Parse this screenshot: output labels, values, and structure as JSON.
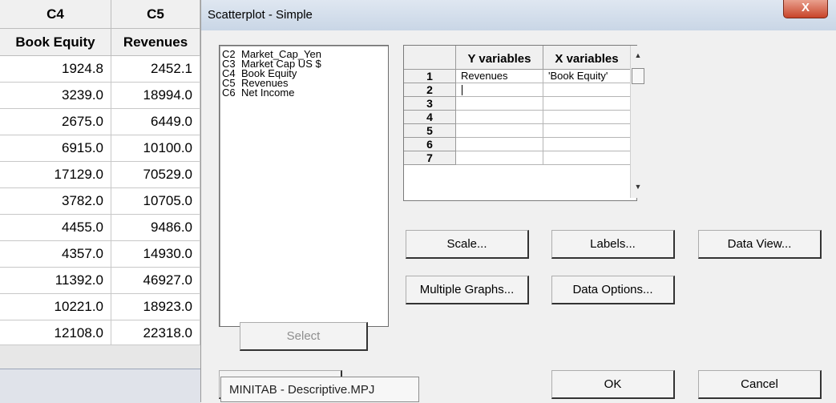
{
  "worksheet": {
    "col_ids": [
      "C4",
      "C5"
    ],
    "col_names": [
      "Book Equity",
      "Revenues"
    ],
    "rows": [
      [
        "1924.8",
        "2452.1"
      ],
      [
        "3239.0",
        "18994.0"
      ],
      [
        "2675.0",
        "6449.0"
      ],
      [
        "6915.0",
        "10100.0"
      ],
      [
        "17129.0",
        "70529.0"
      ],
      [
        "3782.0",
        "10705.0"
      ],
      [
        "4455.0",
        "9486.0"
      ],
      [
        "4357.0",
        "14930.0"
      ],
      [
        "11392.0",
        "46927.0"
      ],
      [
        "10221.0",
        "18923.0"
      ],
      [
        "12108.0",
        "22318.0"
      ]
    ]
  },
  "dialog": {
    "title": "Scatterplot - Simple",
    "close_icon": "close-icon",
    "close_glyph": "X",
    "variables": [
      {
        "col": "C2",
        "name": "Market_Cap_Yen"
      },
      {
        "col": "C3",
        "name": "Market Cap US $"
      },
      {
        "col": "C4",
        "name": "Book Equity"
      },
      {
        "col": "C5",
        "name": "Revenues"
      },
      {
        "col": "C6",
        "name": "Net Income"
      }
    ],
    "grid": {
      "headers": [
        "Y variables",
        "X variables"
      ],
      "row_numbers": [
        "1",
        "2",
        "3",
        "4",
        "5",
        "6",
        "7"
      ],
      "rows": [
        [
          "Revenues",
          "'Book Equity'"
        ],
        [
          "",
          ""
        ],
        [
          "",
          ""
        ],
        [
          "",
          ""
        ],
        [
          "",
          ""
        ],
        [
          "",
          ""
        ],
        [
          "",
          ""
        ]
      ]
    },
    "scroll_up_glyph": "▲",
    "scroll_down_glyph": "▼",
    "buttons": {
      "scale": "Scale...",
      "labels": "Labels...",
      "data_view": "Data View...",
      "multiple_graphs": "Multiple Graphs...",
      "data_options": "Data Options...",
      "select": "Select",
      "ok": "OK",
      "cancel": "Cancel"
    },
    "tooltip": "MINITAB - Descriptive.MPJ"
  }
}
